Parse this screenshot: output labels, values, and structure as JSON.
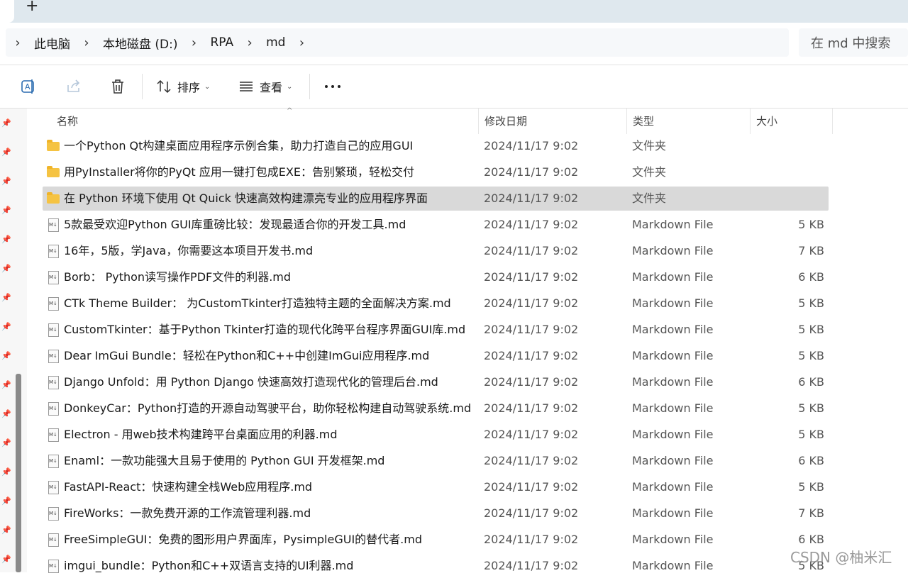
{
  "breadcrumb": {
    "items": [
      "此电脑",
      "本地磁盘 (D:)",
      "RPA",
      "md"
    ]
  },
  "search": {
    "placeholder": "在 md 中搜索"
  },
  "toolbar": {
    "sort_label": "排序",
    "view_label": "查看"
  },
  "columns": {
    "name": "名称",
    "modified": "修改日期",
    "type": "类型",
    "size": "大小"
  },
  "files": [
    {
      "name": "一个Python Qt构建桌面应用程序示例合集，助力打造自己的应用GUI",
      "date": "2024/11/17 9:02",
      "type": "文件夹",
      "size": "",
      "kind": "folder"
    },
    {
      "name": "用PyInstaller将你的PyQt 应用一键打包成EXE：告别繁琐，轻松交付",
      "date": "2024/11/17 9:02",
      "type": "文件夹",
      "size": "",
      "kind": "folder"
    },
    {
      "name": "在 Python 环境下使用 Qt Quick 快速高效构建漂亮专业的应用程序界面",
      "date": "2024/11/17 9:02",
      "type": "文件夹",
      "size": "",
      "kind": "folder",
      "selected": true
    },
    {
      "name": "5款最受欢迎Python GUI库重磅比较：发现最适合你的开发工具.md",
      "date": "2024/11/17 9:02",
      "type": "Markdown File",
      "size": "5 KB",
      "kind": "md"
    },
    {
      "name": "16年，5版，学Java，你需要这本项目开发书.md",
      "date": "2024/11/17 9:02",
      "type": "Markdown File",
      "size": "7 KB",
      "kind": "md"
    },
    {
      "name": "Borb： Python读写操作PDF文件的利器.md",
      "date": "2024/11/17 9:02",
      "type": "Markdown File",
      "size": "6 KB",
      "kind": "md"
    },
    {
      "name": "CTk Theme Builder： 为CustomTkinter打造独特主题的全面解决方案.md",
      "date": "2024/11/17 9:02",
      "type": "Markdown File",
      "size": "5 KB",
      "kind": "md"
    },
    {
      "name": "CustomTkinter：基于Python Tkinter打造的现代化跨平台程序界面GUI库.md",
      "date": "2024/11/17 9:02",
      "type": "Markdown File",
      "size": "5 KB",
      "kind": "md"
    },
    {
      "name": "Dear ImGui Bundle：轻松在Python和C++中创建ImGui应用程序.md",
      "date": "2024/11/17 9:02",
      "type": "Markdown File",
      "size": "5 KB",
      "kind": "md"
    },
    {
      "name": "Django Unfold：用 Python Django 快速高效打造现代化的管理后台.md",
      "date": "2024/11/17 9:02",
      "type": "Markdown File",
      "size": "6 KB",
      "kind": "md"
    },
    {
      "name": "DonkeyCar：Python打造的开源自动驾驶平台，助你轻松构建自动驾驶系统.md",
      "date": "2024/11/17 9:02",
      "type": "Markdown File",
      "size": "5 KB",
      "kind": "md"
    },
    {
      "name": "Electron - 用web技术构建跨平台桌面应用的利器.md",
      "date": "2024/11/17 9:02",
      "type": "Markdown File",
      "size": "5 KB",
      "kind": "md"
    },
    {
      "name": "Enaml：一款功能强大且易于使用的 Python GUI 开发框架.md",
      "date": "2024/11/17 9:02",
      "type": "Markdown File",
      "size": "6 KB",
      "kind": "md"
    },
    {
      "name": "FastAPI-React：快速构建全栈Web应用程序.md",
      "date": "2024/11/17 9:02",
      "type": "Markdown File",
      "size": "5 KB",
      "kind": "md"
    },
    {
      "name": "FireWorks：一款免费开源的工作流管理利器.md",
      "date": "2024/11/17 9:02",
      "type": "Markdown File",
      "size": "7 KB",
      "kind": "md"
    },
    {
      "name": "FreeSimpleGUI：免费的图形用户界面库，PysimpleGUI的替代者.md",
      "date": "2024/11/17 9:02",
      "type": "Markdown File",
      "size": "6 KB",
      "kind": "md"
    },
    {
      "name": "imgui_bundle：Python和C++双语言支持的UI利器.md",
      "date": "2024/11/17 9:02",
      "type": "Markdown File",
      "size": "5 KB",
      "kind": "md"
    }
  ],
  "watermark": "CSDN @柚米汇",
  "colors": {
    "selected_row": "#d9d9d9",
    "folder": "#f5c342",
    "tabstrip": "#dfe8ee"
  }
}
